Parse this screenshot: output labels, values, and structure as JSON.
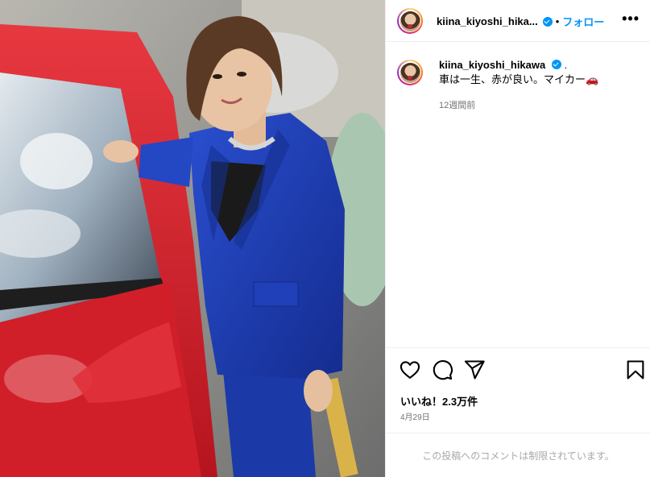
{
  "post": {
    "username_short": "kiina_kiyoshi_hika...",
    "username_full": "kiina_kiyoshi_hikawa",
    "separator": "•",
    "follow_label": "フォロー",
    "more_label": "•••",
    "caption_suffix": ".",
    "caption_body": "車は一生、赤が良い。マイカー🚗",
    "time_ago": "12週間前",
    "likes": "いいね！2.3万件",
    "date": "4月29日",
    "comments_limited": "この投稿へのコメントは制限されています。"
  },
  "icons": {
    "verified": "verified-badge-icon",
    "like": "heart-icon",
    "comment": "comment-icon",
    "share": "share-icon",
    "save": "bookmark-icon",
    "more": "more-options-icon"
  },
  "colors": {
    "accent": "#0095f6",
    "muted": "#737373",
    "suit": "#1e3fb3",
    "car": "#d8232f"
  }
}
